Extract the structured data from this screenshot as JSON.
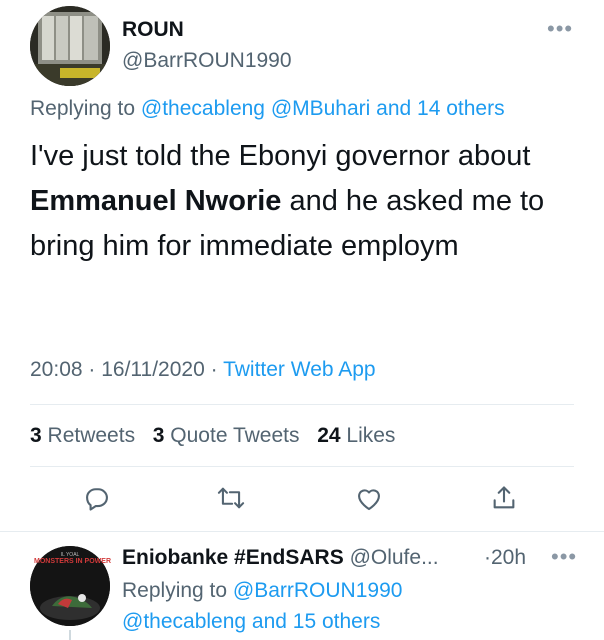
{
  "tweet": {
    "display_name": "ROUN",
    "handle": "@BarrROUN1990",
    "replying_prefix": "Replying to",
    "replying_mentions": "@thecableng @MBuhari and 14 others",
    "text_before": "I've just told the Ebonyi governor about ",
    "text_bold": "Emmanuel Nworie",
    "text_after": " and he asked me to bring him for immediate employm",
    "time": "20:08",
    "date": "16/11/2020",
    "source": "Twitter Web App",
    "stats": {
      "retweets_count": "3",
      "retweets_label": "Retweets",
      "quotes_count": "3",
      "quotes_label": "Quote Tweets",
      "likes_count": "24",
      "likes_label": "Likes"
    }
  },
  "actions": [
    "reply-icon",
    "retweet-icon",
    "like-icon",
    "share-icon"
  ],
  "reply": {
    "display_name": "Eniobanke #EndSARS",
    "handle": "@Olufe...",
    "age": "20h",
    "replying_prefix": "Replying to",
    "replying_mention": "@BarrROUN1990",
    "replying_rest": "@thecableng and 15 others",
    "avatar_caption_top": "IL YOAL",
    "avatar_caption": "MONSTERS IN POWER"
  },
  "colors": {
    "link": "#1d9bf0",
    "muted": "#536471",
    "text": "#0f1419",
    "divider": "#e6ecf0"
  }
}
